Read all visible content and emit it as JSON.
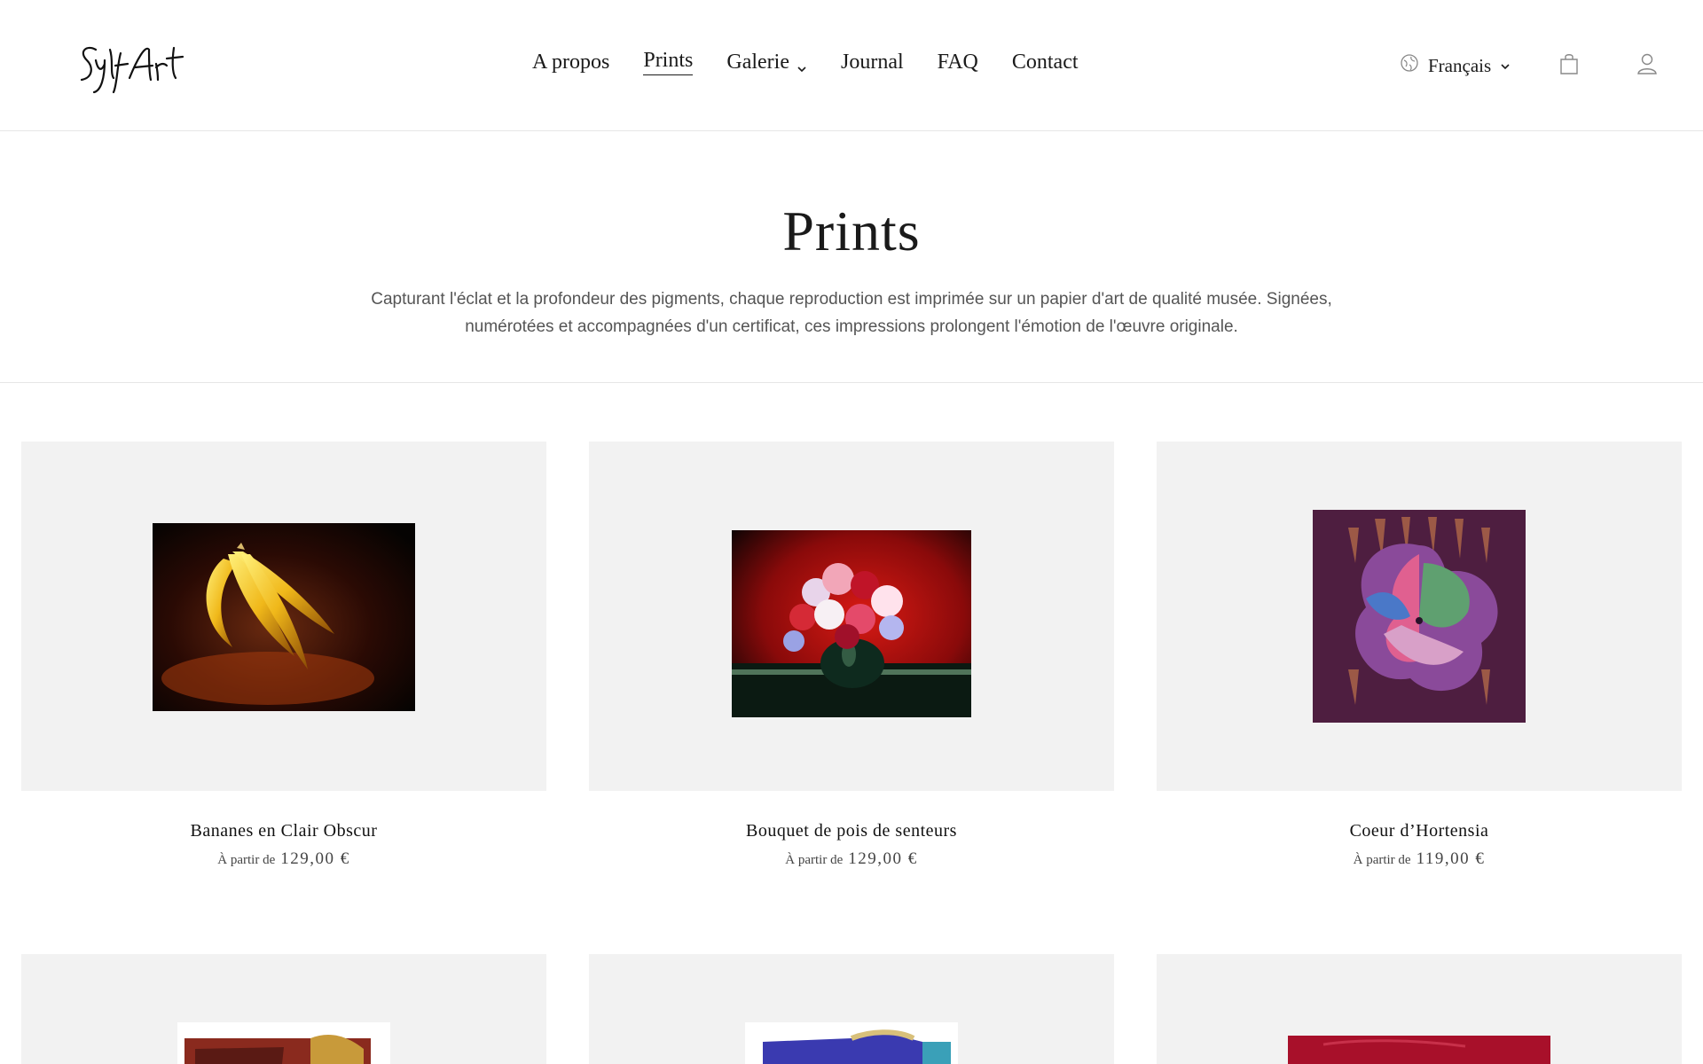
{
  "header": {
    "logo_text": "SylfArt",
    "nav": [
      {
        "label": "A propos"
      },
      {
        "label": "Prints"
      },
      {
        "label": "Galerie"
      },
      {
        "label": "Journal"
      },
      {
        "label": "FAQ"
      },
      {
        "label": "Contact"
      }
    ],
    "active_nav": "Prints",
    "language": "Français"
  },
  "hero": {
    "title": "Prints",
    "description_line1": "Capturant l'éclat et la profondeur des pigments, chaque reproduction est imprimée sur un papier d'art de qualité musée. Signées,",
    "description_line2": "numérotées et accompagnées d'un certificat, ces impressions prolongent l'émotion de l'œuvre originale."
  },
  "products": [
    {
      "title": "Bananes en Clair Obscur",
      "price_prefix": "À partir de",
      "price": "129,00 €"
    },
    {
      "title": "Bouquet de pois de senteurs",
      "price_prefix": "À partir de",
      "price": "129,00 €"
    },
    {
      "title": "Coeur d’Hortensia",
      "price_prefix": "À partir de",
      "price": "119,00 €"
    }
  ],
  "colors": {
    "text": "#1a1a1a",
    "muted": "#555555",
    "card_bg": "#f2f2f2",
    "divider": "#e6e6e6"
  },
  "icons": [
    "globe-icon",
    "chevron-down-icon",
    "shopping-bag-icon",
    "user-icon"
  ]
}
